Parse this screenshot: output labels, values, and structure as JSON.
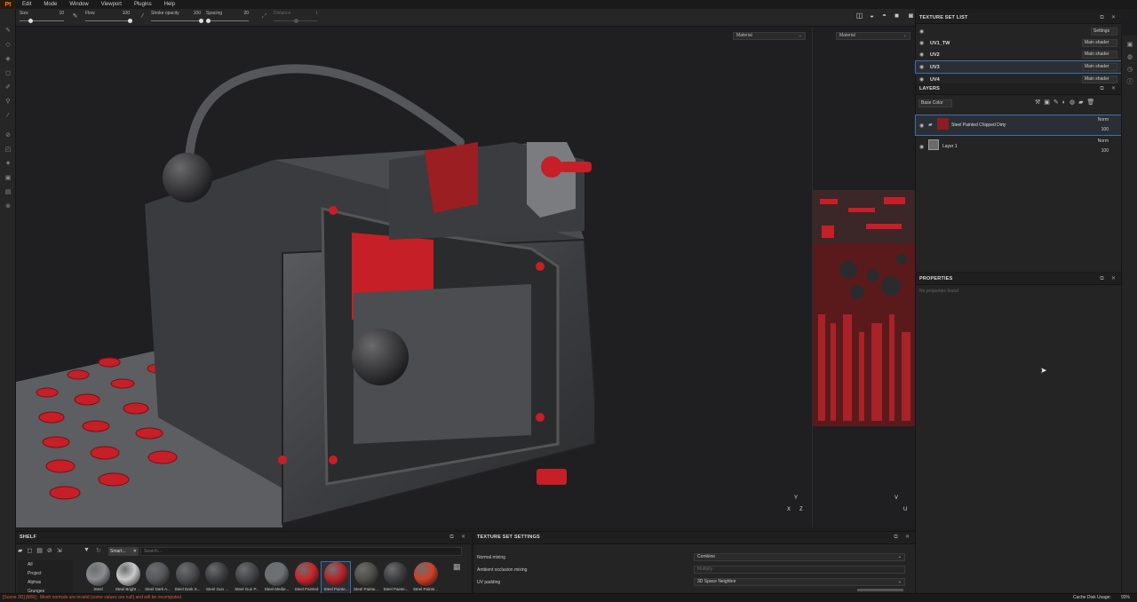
{
  "app": {
    "logo": "Pt"
  },
  "menu": [
    "Edit",
    "Mode",
    "Window",
    "Viewport",
    "Plugins",
    "Help"
  ],
  "toolbar": {
    "size": {
      "label": "Size",
      "value": "10",
      "level": 0.25
    },
    "flow": {
      "label": "Flow",
      "value": "100",
      "level": 1.0
    },
    "stroke_opacity": {
      "label": "Stroke opacity",
      "value": "100",
      "level": 1.0
    },
    "spacing": {
      "label": "Spacing",
      "value": "20",
      "level": 0.05
    },
    "distance": {
      "label": "Distance",
      "value": "1",
      "level": 0.5
    }
  },
  "viewport": {
    "mode3d": "Material",
    "mode2d": "Material",
    "axes3d": {
      "y": "Y",
      "z": "Z",
      "x": "X"
    },
    "axes2d": {
      "v": "V",
      "u": "U"
    }
  },
  "texture_set_list": {
    "title": "TEXTURE SET LIST",
    "settings_label": "Settings",
    "sets": [
      {
        "name": "UV1_TW",
        "shader": "Main shader"
      },
      {
        "name": "UV2",
        "shader": "Main shader"
      },
      {
        "name": "UV3",
        "shader": "Main shader"
      },
      {
        "name": "UV4",
        "shader": "Main shader"
      }
    ]
  },
  "layers": {
    "title": "LAYERS",
    "channel": "Base Color",
    "items": [
      {
        "name": "Steel Painted Chipped Dirty",
        "blend": "Norm",
        "opacity": "100"
      },
      {
        "name": "Layer 1",
        "blend": "Norm",
        "opacity": "100"
      }
    ]
  },
  "properties": {
    "title": "PROPERTIES",
    "empty": "No properties found"
  },
  "shelf": {
    "title": "SHELF",
    "filter_tag": "Smart...",
    "search_placeholder": "Search...",
    "categories": [
      "All",
      "Project",
      "Alphas",
      "Grunges"
    ],
    "materials": [
      {
        "name": "Steel",
        "color": "#8a8c8f"
      },
      {
        "name": "Steel Bright ...",
        "color": "#c9cbcd"
      },
      {
        "name": "Steel Dark A...",
        "color": "#55575a"
      },
      {
        "name": "Steel Dark S...",
        "color": "#4a4c4f"
      },
      {
        "name": "Steel Gun ...",
        "color": "#3c3e41"
      },
      {
        "name": "Steel Gun P...",
        "color": "#45474a"
      },
      {
        "name": "Steel Medie...",
        "color": "#6d7174"
      },
      {
        "name": "Steel Painted",
        "color": "#c8262b"
      },
      {
        "name": "Steel Painte...",
        "color": "#b72429"
      },
      {
        "name": "Steel Painte...",
        "color": "#4e4d46"
      },
      {
        "name": "Steel Painte...",
        "color": "#3e3f42"
      },
      {
        "name": "Steel Painte...",
        "color": "#d0402a"
      }
    ]
  },
  "tss": {
    "title": "TEXTURE SET SETTINGS",
    "rows": [
      {
        "label": "Normal mixing",
        "value": "Combine"
      },
      {
        "label": "Ambient occlusion mixing",
        "value": "Multiply"
      },
      {
        "label": "UV padding",
        "value": "3D Space Neighbor"
      }
    ]
  },
  "status": {
    "message": "[Scene 3D] [MSI] : Mesh normals are invalid (some values are null) and will be recomputed",
    "cache_label": "Cache Disk Usage:",
    "cache_value": "93%"
  },
  "colors": {
    "accent": "#3d6fa8",
    "warning": "#e0583a",
    "brand": "#ff7a1a"
  }
}
